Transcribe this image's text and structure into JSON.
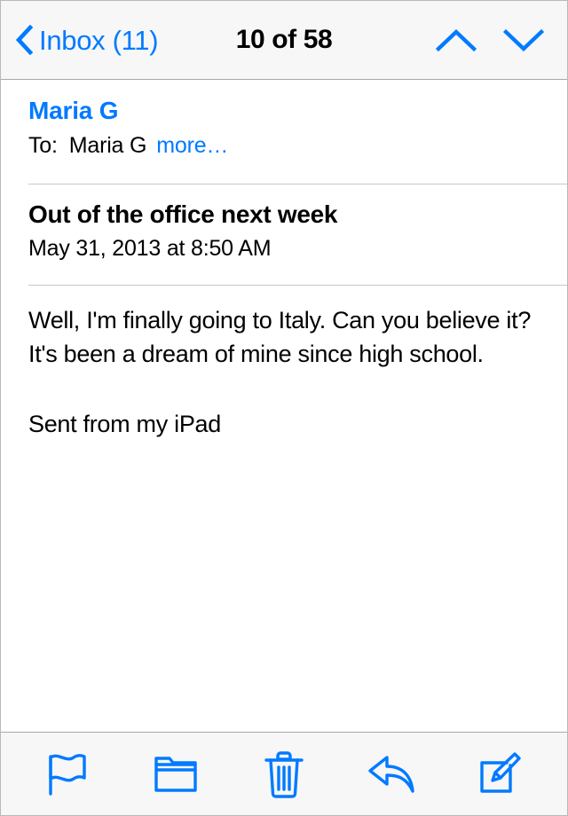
{
  "nav": {
    "back_label": "Inbox (11)",
    "back_icon": "chevron-left-icon",
    "title": "10 of 58",
    "previous_icon": "chevron-up-icon",
    "next_icon": "chevron-down-icon"
  },
  "message": {
    "sender": "Maria G",
    "recipient_label": "To:",
    "recipient": "Maria G",
    "more_label": "more…",
    "subject": "Out of the office next week",
    "date": "May 31, 2013 at 8:50 AM",
    "body": "Well, I'm finally going to Italy. Can you believe it? It's been a dream of mine since high school.",
    "signature": "Sent from my iPad"
  },
  "toolbar": {
    "items": [
      {
        "name": "flag-icon",
        "label": "Flag"
      },
      {
        "name": "folder-icon",
        "label": "Move to folder"
      },
      {
        "name": "trash-icon",
        "label": "Delete"
      },
      {
        "name": "reply-icon",
        "label": "Reply"
      },
      {
        "name": "compose-icon",
        "label": "Compose"
      }
    ]
  },
  "colors": {
    "accent": "#007AFF",
    "text": "#000000",
    "bar_background": "#F7F7F7",
    "separator": "#C8C8C8",
    "content_background": "#FFFFFF"
  }
}
